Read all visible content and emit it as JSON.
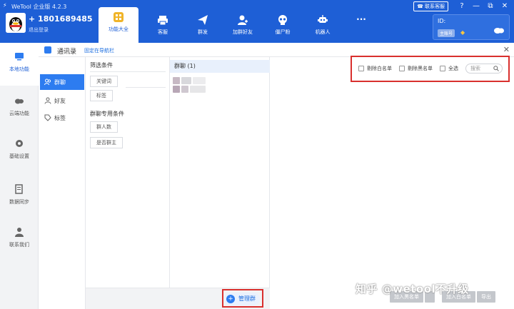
{
  "titlebar": {
    "app_title": "WeTool 企业版 4.2.3",
    "account_name": "+ 1801689485",
    "logout_label": "退出登录",
    "service_label": "联系客服",
    "id_label": "ID:",
    "id_badge": "主账号"
  },
  "nav": {
    "tabs": [
      {
        "label": "功能大全",
        "icon": "grid-icon"
      },
      {
        "label": "客服",
        "icon": "printer-icon"
      },
      {
        "label": "群发",
        "icon": "send-icon"
      },
      {
        "label": "加群好友",
        "icon": "add-user-icon"
      },
      {
        "label": "僵尸粉",
        "icon": "skull-icon"
      },
      {
        "label": "机器人",
        "icon": "robot-icon"
      },
      {
        "label": "...",
        "icon": "more-icon"
      }
    ]
  },
  "sidebar": {
    "items": [
      {
        "label": "本地功能",
        "icon": "monitor-icon"
      },
      {
        "label": "云端功能",
        "icon": "cloud-icon"
      },
      {
        "label": "基础设置",
        "icon": "gear-icon"
      },
      {
        "label": "数据同步",
        "icon": "sync-icon"
      },
      {
        "label": "联系我们",
        "icon": "person-icon"
      }
    ]
  },
  "subheader": {
    "title": "通讯录",
    "link": "固定在导航栏"
  },
  "categories": [
    {
      "label": "群聊",
      "icon": "group-icon"
    },
    {
      "label": "好友",
      "icon": "friend-icon"
    },
    {
      "label": "标签",
      "icon": "tag-icon"
    }
  ],
  "filters": {
    "title": "筛选条件",
    "chips": [
      "关键词",
      "标签"
    ],
    "group_title": "群聊专用条件",
    "group_chips": [
      "群人数",
      "是否群主"
    ]
  },
  "group_list": {
    "header": "群聊 (1)"
  },
  "toolbar": {
    "exclude_whitelist": "剔除白名单",
    "exclude_blacklist": "剔除黑名单",
    "select_all": "全选",
    "search_placeholder": "搜索"
  },
  "footer": {
    "manage_label": "管理群",
    "add_blacklist": "加入黑名单",
    "add_whitelist": "加入白名单",
    "export": "导出"
  },
  "watermark": "知乎 @wetool不升级",
  "colors": {
    "brand": "#1e5fd6",
    "accent": "#2d7cf0",
    "highlight_box": "#d9302e"
  }
}
